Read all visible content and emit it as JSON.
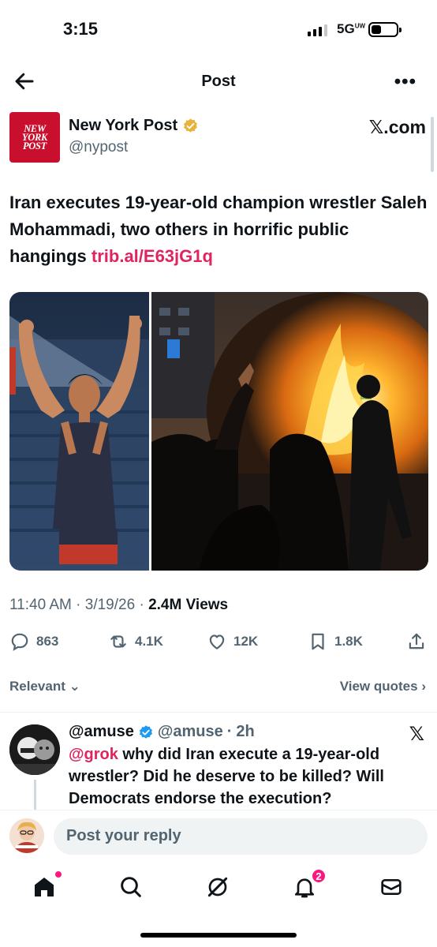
{
  "status_bar": {
    "time": "3:15",
    "network": "5G",
    "network_sup": "UW"
  },
  "nav": {
    "title": "Post",
    "more": "•••"
  },
  "author": {
    "name": "New York Post",
    "handle": "@nypost",
    "logo_lines": [
      "NEW",
      "YORK",
      "POST"
    ],
    "source": "𝕏.com",
    "verified": true
  },
  "post": {
    "text": "Iran executes 19-year-old champion wrestler Saleh Mohammadi, two others in horrific public hangings ",
    "link": "trib.al/E63jG1q",
    "time": "11:40 AM",
    "date": "3/19/26",
    "views": "2.4M",
    "views_label": "Views"
  },
  "actions": {
    "replies": "863",
    "reposts": "4.1K",
    "likes": "12K",
    "bookmarks": "1.8K"
  },
  "sort": {
    "label": "Relevant",
    "quotes": "View quotes"
  },
  "reply": {
    "name": "@amuse",
    "handle": "@amuse",
    "time": "2h",
    "mention": "@grok",
    "text": " why did Iran execute a 19-year-old wrestler? Did he deserve to be killed? Will Democrats endorse the execution?"
  },
  "composer": {
    "placeholder": "Post your reply"
  },
  "tabbar": {
    "notifications_badge": "2"
  },
  "colors": {
    "accent_link": "#e0245e",
    "badge": "#f91880",
    "verified_gold": "#e8b33a",
    "verified_blue": "#1d9bf0",
    "brand_red": "#c8102e"
  }
}
